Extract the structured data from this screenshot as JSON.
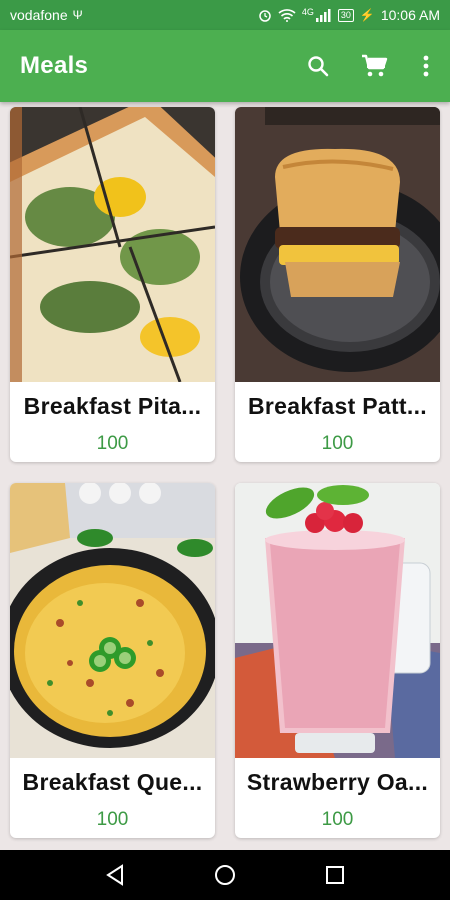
{
  "status_bar": {
    "carrier": "vodafone",
    "battery": "30",
    "time": "10:06 AM",
    "network": "4G"
  },
  "app_bar": {
    "title": "Meals",
    "actions": [
      "search-icon",
      "cart-icon",
      "more-vert-icon"
    ]
  },
  "meals": [
    {
      "name": "Breakfast Pita...",
      "price": "100",
      "image": "pizza-pita"
    },
    {
      "name": "Breakfast Patt...",
      "price": "100",
      "image": "patty-sandwich"
    },
    {
      "name": "Breakfast Que...",
      "price": "100",
      "image": "quesadilla-skillet"
    },
    {
      "name": "Strawberry Oa...",
      "price": "100",
      "image": "strawberry-smoothie"
    }
  ],
  "colors": {
    "primary": "#4caf50",
    "status": "#3b9a47",
    "price": "#3d9a45"
  },
  "nav": [
    "back-icon",
    "home-icon",
    "recents-icon"
  ]
}
